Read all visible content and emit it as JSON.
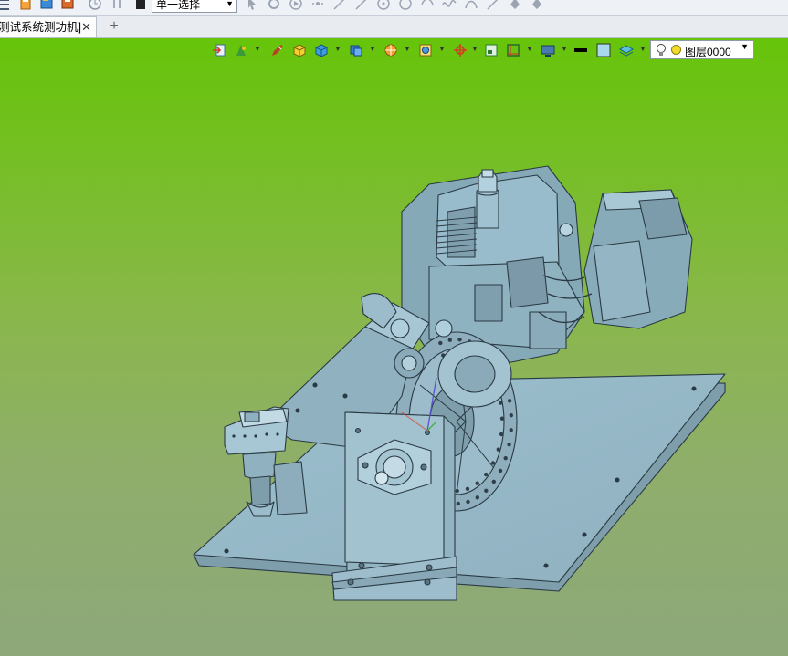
{
  "toolbar": {
    "selection_mode": "单一选择"
  },
  "document_tab": {
    "title": "测试系统测功机]",
    "close_glyph": "✕"
  },
  "new_tab_glyph": "+",
  "view_toolbar": {
    "layer_name": "图层0000"
  },
  "colors": {
    "background_top": "#66c40a",
    "background_bottom": "#8ea87a",
    "model_fill": "#8fb3c2",
    "model_edge": "#2a3a44",
    "accent_yellow": "#f2dc2a"
  }
}
